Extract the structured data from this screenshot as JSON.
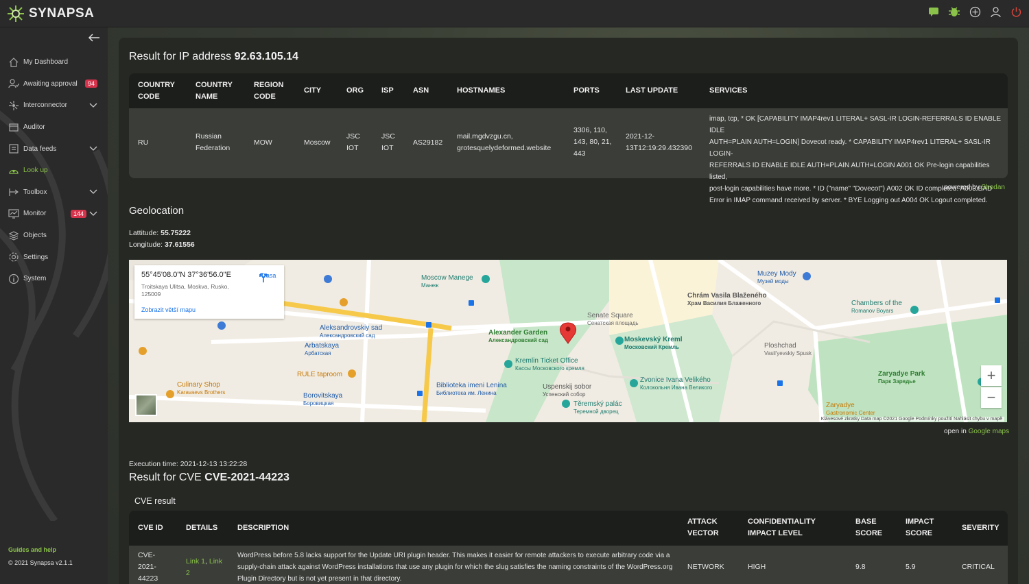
{
  "app": {
    "name": "SYNAPSA",
    "colors": {
      "accent": "#8bc34a",
      "badge": "#d6334c",
      "danger": "#d9443b"
    }
  },
  "topbar": {
    "icons": [
      "chat-icon",
      "bug-icon",
      "add-circle-icon",
      "user-icon",
      "power-icon"
    ]
  },
  "sidebar": {
    "items": [
      {
        "label": "My Dashboard",
        "icon": "home-icon"
      },
      {
        "label": "Awaiting approval",
        "icon": "approval-icon",
        "badge": "94"
      },
      {
        "label": "Interconnector",
        "icon": "interconnector-icon",
        "expandable": true
      },
      {
        "label": "Auditor",
        "icon": "auditor-icon"
      },
      {
        "label": "Data feeds",
        "icon": "data-feeds-icon",
        "expandable": true
      },
      {
        "label": "Look up",
        "icon": "lookup-icon",
        "active": true
      },
      {
        "label": "Toolbox",
        "icon": "toolbox-icon",
        "expandable": true
      },
      {
        "label": "Monitor",
        "icon": "monitor-icon",
        "badge": "144",
        "expandable": true
      },
      {
        "label": "Objects",
        "icon": "objects-icon"
      },
      {
        "label": "Settings",
        "icon": "settings-icon"
      },
      {
        "label": "System",
        "icon": "system-icon"
      }
    ],
    "guides": "Guides and help",
    "copyright": "© 2021 Synapsa v2.1.1"
  },
  "ip_result": {
    "title_prefix": "Result for IP address",
    "ip": "92.63.105.14",
    "headers": {
      "country_code": [
        "COUNTRY",
        "CODE"
      ],
      "country_name": [
        "COUNTRY",
        "NAME"
      ],
      "region_code": [
        "REGION",
        "CODE"
      ],
      "city": "CITY",
      "org": "ORG",
      "isp": "ISP",
      "asn": "ASN",
      "hostnames": "HOSTNAMES",
      "ports": "PORTS",
      "last_update": "LAST UPDATE",
      "services": "SERVICES"
    },
    "row": {
      "country_code": "RU",
      "country_name": [
        "Russian",
        "Federation"
      ],
      "region_code": "MOW",
      "city": "Moscow",
      "org": [
        "JSC",
        "IOT"
      ],
      "isp": [
        "JSC",
        "IOT"
      ],
      "asn": "AS29182",
      "hostnames": [
        "mail.mgdvzgu.cn,",
        "grotesquelydeformed.website"
      ],
      "ports": [
        "3306, 110,",
        "143, 80, 21,",
        "443"
      ],
      "last_update": [
        "2021-12-",
        "13T12:19:29.432390"
      ],
      "services": [
        "imap, tcp, * OK [CAPABILITY IMAP4rev1 LITERAL+ SASL-IR LOGIN-REFERRALS ID ENABLE IDLE",
        "AUTH=PLAIN AUTH=LOGIN] Dovecot ready. * CAPABILITY IMAP4rev1 LITERAL+ SASL-IR LOGIN-",
        "REFERRALS ID ENABLE IDLE AUTH=PLAIN AUTH=LOGIN A001 OK Pre-login capabilities listed,",
        "post-login capabilities have more. * ID (\"name\" \"Dovecot\") A002 OK ID completed. A003 BAD",
        "Error in IMAP command received by server. * BYE Logging out A004 OK Logout completed."
      ]
    },
    "powered_by": "powered by",
    "powered_link": "Shodan"
  },
  "geolocation": {
    "title": "Geolocation",
    "latitude_label": "Lattitude:",
    "latitude": "55.75222",
    "longitude_label": "Longitude:",
    "longitude": "37.61556",
    "map": {
      "card_coord": "55°45'08.0\"N 37°36'56.0\"E",
      "card_address": "Troitskaya Ulitsa, Moskva, Rusko, 125009",
      "card_bigger": "Zobrazit větší mapu",
      "card_route": "Trasa",
      "footer": "Klávesové zkratky  Data map ©2021 Google  Podmínky použití  Nahlásit chybu v mapě",
      "zoom_in": "+",
      "zoom_out": "−",
      "labels": [
        {
          "text": "Moscow Manege",
          "sub": "Манеж",
          "color": "#1e7b6f"
        },
        {
          "text": "Alexander Garden",
          "sub": "Александровский сад",
          "color": "#2e7d32"
        },
        {
          "text": "Senate Square",
          "sub": "Сенатская площадь",
          "color": "#666"
        },
        {
          "text": "Moskevský Kreml",
          "sub": "Московский Кремль",
          "color": "#1e7b6f"
        },
        {
          "text": "Kremlin Ticket Office",
          "sub": "Кассы Московского кремля",
          "color": "#1e7b6f"
        },
        {
          "text": "Uspenskij sobor",
          "sub": "Успенский собор",
          "color": "#555"
        },
        {
          "text": "Chrám Vasila Blaženého",
          "sub": "Храм Василия Блаженного",
          "color": "#555"
        },
        {
          "text": "Muzey Mody",
          "sub": "Музей моды",
          "color": "#1e5aa8"
        },
        {
          "text": "Chambers of the",
          "sub": "Romanov Boyars",
          "color": "#1e7b6f"
        },
        {
          "text": "Zaryadye Park",
          "sub": "Парк Зарядье",
          "color": "#2e7d32"
        },
        {
          "text": "Aleksandrovskiy sad",
          "sub": "Александровский сад",
          "color": "#1e5aa8"
        },
        {
          "text": "Arbatskaya",
          "sub": "Арбатская",
          "color": "#1e5aa8"
        },
        {
          "text": "RULE taproom",
          "sub": "",
          "color": "#c77700"
        },
        {
          "text": "Biblioteka imeni Lenina",
          "sub": "Библиотека им. Ленина",
          "color": "#1e5aa8"
        },
        {
          "text": "Borovitskaya",
          "sub": "Боровицкая",
          "color": "#1e5aa8"
        },
        {
          "text": "Culinary Shop",
          "sub": "Karavaevs Brothers",
          "color": "#c77700"
        },
        {
          "text": "Zvonice Ivana Velikého",
          "sub": "Колокольня Ивана Великого",
          "color": "#1e7b6f"
        },
        {
          "text": "Těremský palác",
          "sub": "Теремной дворец",
          "color": "#1e7b6f"
        },
        {
          "text": "Ploshchad",
          "sub": "Vasil'yevskiy Spusk",
          "color": "#666"
        },
        {
          "text": "Zaryadye",
          "sub": "Gastronomic Center",
          "color": "#c77700"
        }
      ]
    },
    "open_in": "open in",
    "open_link": "Google maps"
  },
  "cve_result": {
    "exec_time": "Execution time: 2021-12-13 13:22:28",
    "title_prefix": "Result for CVE",
    "cve": "CVE-2021-44223",
    "subtitle": "CVE result",
    "headers": {
      "cve_id": "CVE ID",
      "details": "DETAILS",
      "description": "DESCRIPTION",
      "attack_vector": [
        "ATTACK",
        "VECTOR"
      ],
      "confidentiality": [
        "CONFIDENTIALITY",
        "IMPACT LEVEL"
      ],
      "base_score": [
        "BASE",
        "SCORE"
      ],
      "impact_score": [
        "IMPACT",
        "SCORE"
      ],
      "severity": "SEVERITY"
    },
    "row": {
      "cve_id": [
        "CVE-",
        "2021-",
        "44223"
      ],
      "link1": "Link 1",
      "sep": ", ",
      "link2a": "Link",
      "link2b": "2",
      "description": [
        "WordPress before 5.8 lacks support for the Update URI plugin header. This makes it easier for remote attackers to execute arbitrary code via a",
        "supply-chain attack against WordPress installations that use any plugin for which the slug satisfies the naming constraints of the WordPress.org",
        "Plugin Directory but is not yet present in that directory."
      ],
      "attack_vector": "NETWORK",
      "confidentiality": "HIGH",
      "base_score": "9.8",
      "impact_score": "5.9",
      "severity": "CRITICAL"
    }
  }
}
